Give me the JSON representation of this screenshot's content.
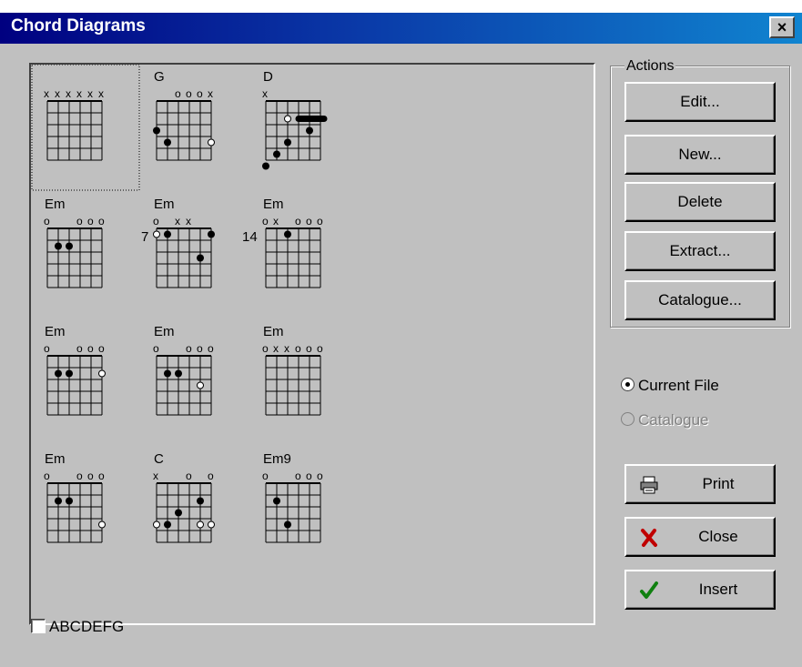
{
  "window": {
    "title": "Chord Diagrams",
    "close_glyph": "×"
  },
  "actions": {
    "group_label": "Actions",
    "edit": "Edit...",
    "new": "New...",
    "delete": "Delete",
    "extract": "Extract...",
    "catalogue": "Catalogue..."
  },
  "source": {
    "current_file": "Current File",
    "catalogue": "Catalogue",
    "selected": "current_file"
  },
  "buttons": {
    "print": "Print",
    "close": "Close",
    "insert": "Insert"
  },
  "filter": {
    "label": "ABCDEFG",
    "checked": false
  },
  "chords": [
    {
      "name": "",
      "top": [
        "x",
        "x",
        "x",
        "x",
        "x",
        "x"
      ],
      "fret_label": "",
      "dots": [],
      "open_dots": [],
      "barre": null,
      "selected": true
    },
    {
      "name": "G",
      "top": [
        "",
        "",
        "o",
        "o",
        "o",
        "x"
      ],
      "fret_label": "",
      "dots": [
        [
          1,
          3
        ],
        [
          0,
          2
        ]
      ],
      "open_dots": [
        [
          5,
          3
        ]
      ],
      "barre": null,
      "selected": false
    },
    {
      "name": "D",
      "top": [
        "x",
        "",
        "",
        "",
        "",
        ""
      ],
      "fret_label": "",
      "dots": [
        [
          0,
          5
        ],
        [
          1,
          4
        ],
        [
          2,
          3
        ],
        [
          4,
          2
        ]
      ],
      "open_dots": [
        [
          2,
          1
        ]
      ],
      "barre": [
        3,
        5,
        1
      ],
      "selected": false
    },
    {
      "name": "Em",
      "top": [
        "o",
        "",
        "",
        "o",
        "o",
        "o"
      ],
      "fret_label": "",
      "dots": [
        [
          1,
          1
        ],
        [
          2,
          1
        ]
      ],
      "open_dots": [],
      "barre": null,
      "selected": false
    },
    {
      "name": "Em",
      "top": [
        "o",
        "",
        "x",
        "x",
        "",
        ""
      ],
      "fret_label": "7",
      "dots": [
        [
          1,
          0
        ],
        [
          5,
          0
        ],
        [
          4,
          2
        ]
      ],
      "open_dots": [
        [
          0,
          0
        ]
      ],
      "barre": null,
      "selected": false
    },
    {
      "name": "Em",
      "top": [
        "o",
        "x",
        "",
        "o",
        "o",
        "o"
      ],
      "fret_label": "14",
      "dots": [
        [
          2,
          0
        ]
      ],
      "open_dots": [],
      "barre": null,
      "selected": false
    },
    {
      "name": "Em",
      "top": [
        "o",
        "",
        "",
        "o",
        "o",
        "o"
      ],
      "fret_label": "",
      "dots": [
        [
          1,
          1
        ],
        [
          2,
          1
        ]
      ],
      "open_dots": [
        [
          5,
          1
        ]
      ],
      "barre": null,
      "selected": false
    },
    {
      "name": "Em",
      "top": [
        "o",
        "",
        "",
        "o",
        "o",
        "o"
      ],
      "fret_label": "",
      "dots": [
        [
          1,
          1
        ],
        [
          2,
          1
        ]
      ],
      "open_dots": [
        [
          4,
          2
        ]
      ],
      "barre": null,
      "selected": false
    },
    {
      "name": "Em",
      "top": [
        "o",
        "x",
        "x",
        "o",
        "o",
        "o"
      ],
      "fret_label": "",
      "dots": [],
      "open_dots": [],
      "barre": null,
      "selected": false
    },
    {
      "name": "Em",
      "top": [
        "o",
        "",
        "",
        "o",
        "o",
        "o"
      ],
      "fret_label": "",
      "dots": [
        [
          1,
          1
        ],
        [
          2,
          1
        ]
      ],
      "open_dots": [
        [
          5,
          3
        ]
      ],
      "barre": null,
      "selected": false
    },
    {
      "name": "C",
      "top": [
        "x",
        "",
        "",
        "o",
        "",
        "o"
      ],
      "fret_label": "",
      "dots": [
        [
          1,
          3
        ],
        [
          2,
          2
        ],
        [
          4,
          1
        ]
      ],
      "open_dots": [
        [
          0,
          3
        ],
        [
          4,
          3
        ],
        [
          5,
          3
        ]
      ],
      "barre": null,
      "selected": false
    },
    {
      "name": "Em9",
      "top": [
        "o",
        "",
        "",
        "o",
        "o",
        "o"
      ],
      "fret_label": "",
      "dots": [
        [
          1,
          1
        ],
        [
          2,
          3
        ]
      ],
      "open_dots": [],
      "barre": null,
      "selected": false
    }
  ]
}
